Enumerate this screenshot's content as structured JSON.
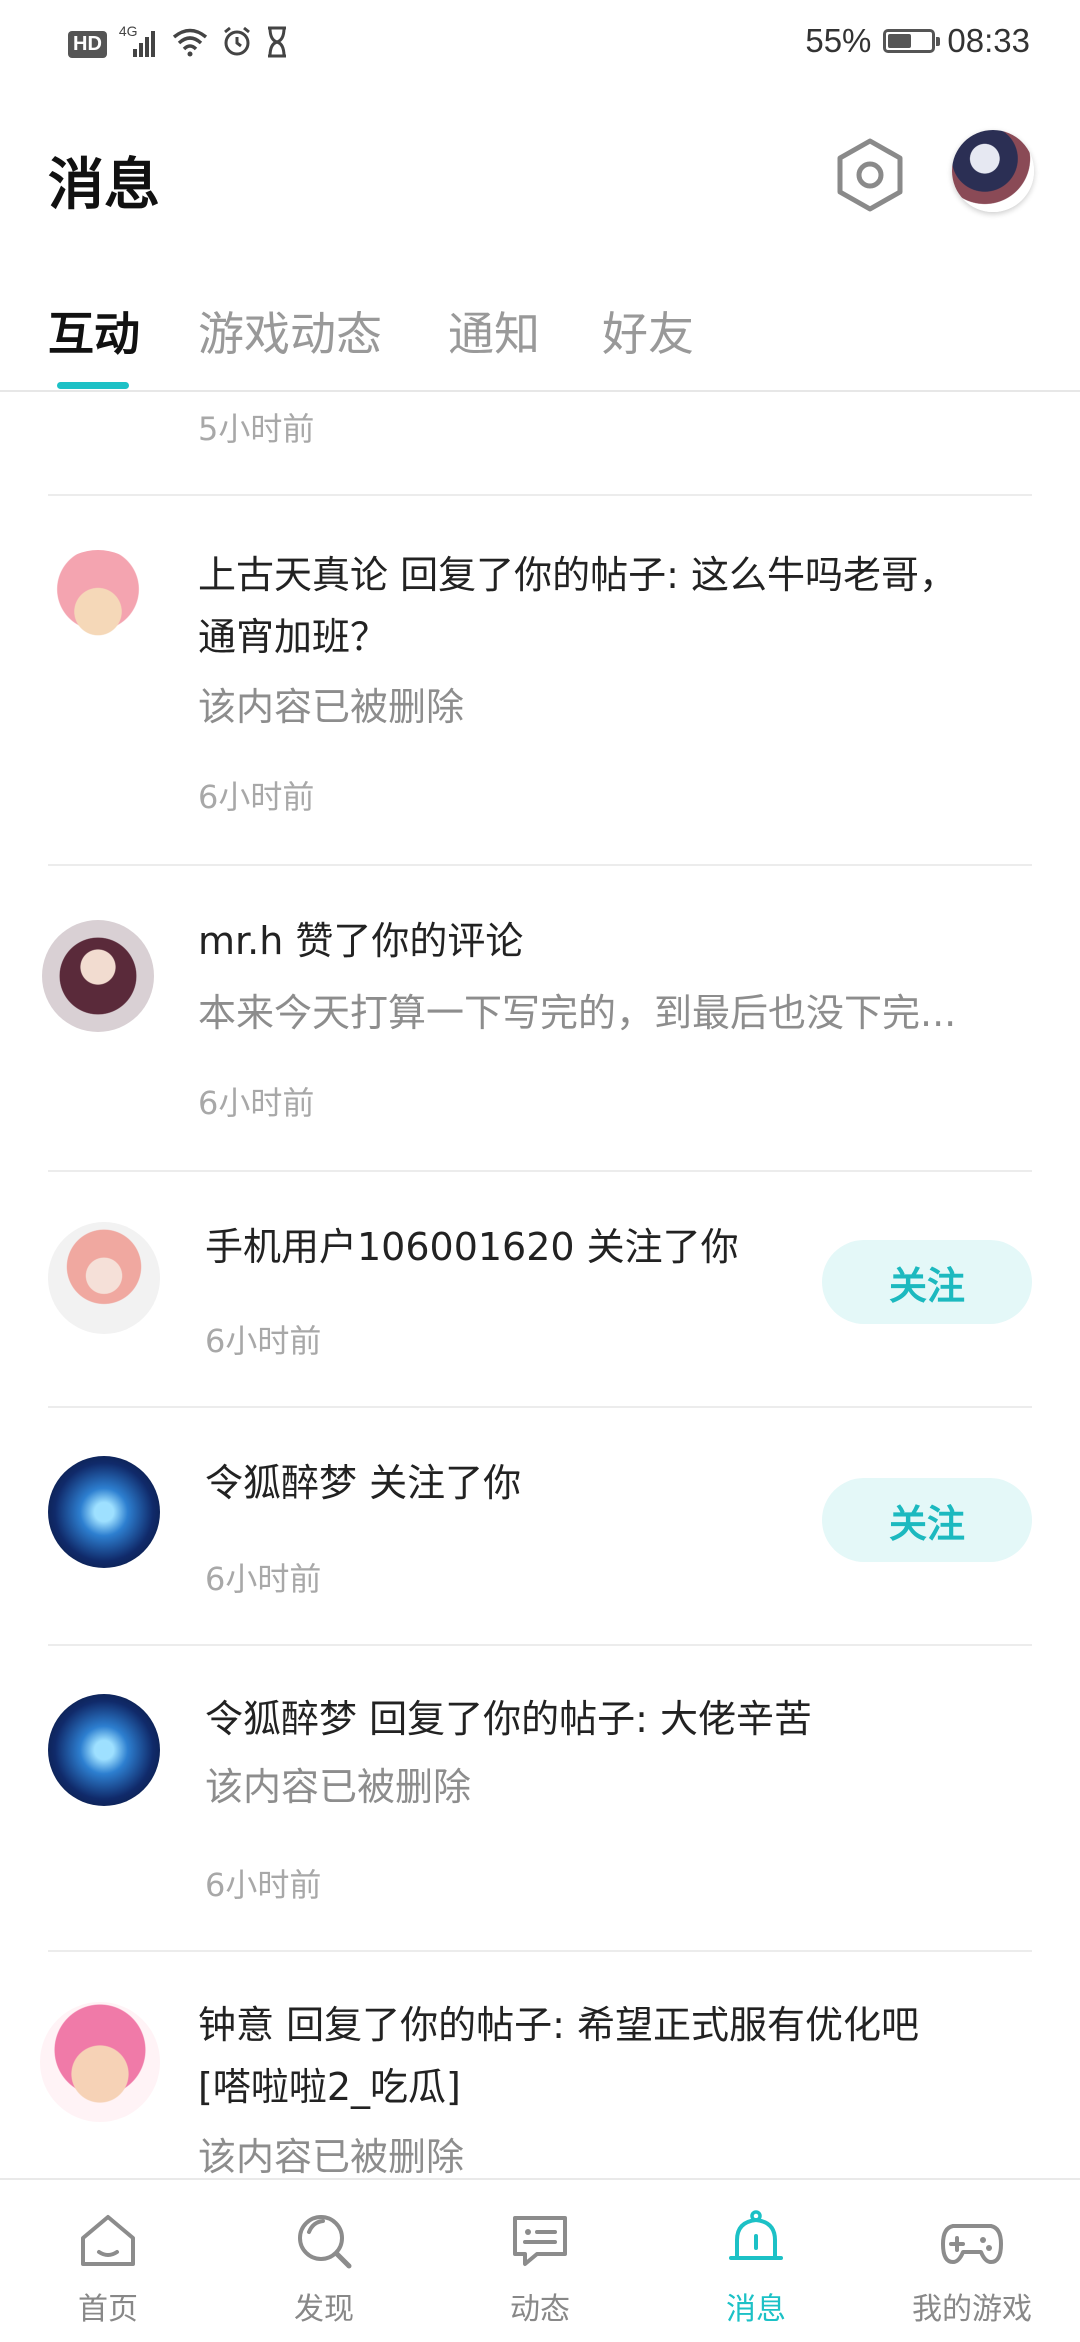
{
  "status_bar": {
    "hd": "HD",
    "network": "4G",
    "battery_percent": "55%",
    "battery_level": 0.55,
    "time": "08:33",
    "icons": [
      "signal-icon",
      "wifi-icon",
      "alarm-icon",
      "hourglass-icon",
      "battery-icon"
    ]
  },
  "header": {
    "title": "消息",
    "settings_icon": "settings-hex-icon"
  },
  "tabs": [
    {
      "label": "互动",
      "active": true
    },
    {
      "label": "游戏动态",
      "active": false
    },
    {
      "label": "通知",
      "active": false
    },
    {
      "label": "好友",
      "active": false
    }
  ],
  "feed": {
    "partial_time": "5小时前",
    "items": [
      {
        "title_line1": "上古天真论 回复了你的帖子: 这么牛吗老哥，",
        "title_line2": "通宵加班？",
        "sub": "该内容已被删除",
        "time": "6小时前"
      },
      {
        "title_line1": "mr.h 赞了你的评论",
        "sub": "本来今天打算一下写完的，到最后也没下完...",
        "time": "6小时前"
      },
      {
        "title_line1": "手机用户106001620 关注了你",
        "time": "6小时前",
        "button": "关注"
      },
      {
        "title_line1": "令狐醉梦 关注了你",
        "time": "6小时前",
        "button": "关注"
      },
      {
        "title_line1": "令狐醉梦 回复了你的帖子: 大佬辛苦",
        "sub": "该内容已被删除",
        "time": "6小时前"
      },
      {
        "title_line1": "钟意 回复了你的帖子: 希望正式服有优化吧",
        "title_line2": "[嗒啦啦2_吃瓜]",
        "sub": "该内容已被删除"
      }
    ]
  },
  "bottom_nav": [
    {
      "label": "首页",
      "icon": "home-icon",
      "active": false
    },
    {
      "label": "发现",
      "icon": "discover-icon",
      "active": false
    },
    {
      "label": "动态",
      "icon": "feed-icon",
      "active": false
    },
    {
      "label": "消息",
      "icon": "bell-icon",
      "active": true
    },
    {
      "label": "我的游戏",
      "icon": "gamepad-icon",
      "active": false
    }
  ],
  "colors": {
    "accent": "#1cc1c6",
    "follow_bg": "#e4f8f8",
    "muted": "#a8a8a8"
  }
}
